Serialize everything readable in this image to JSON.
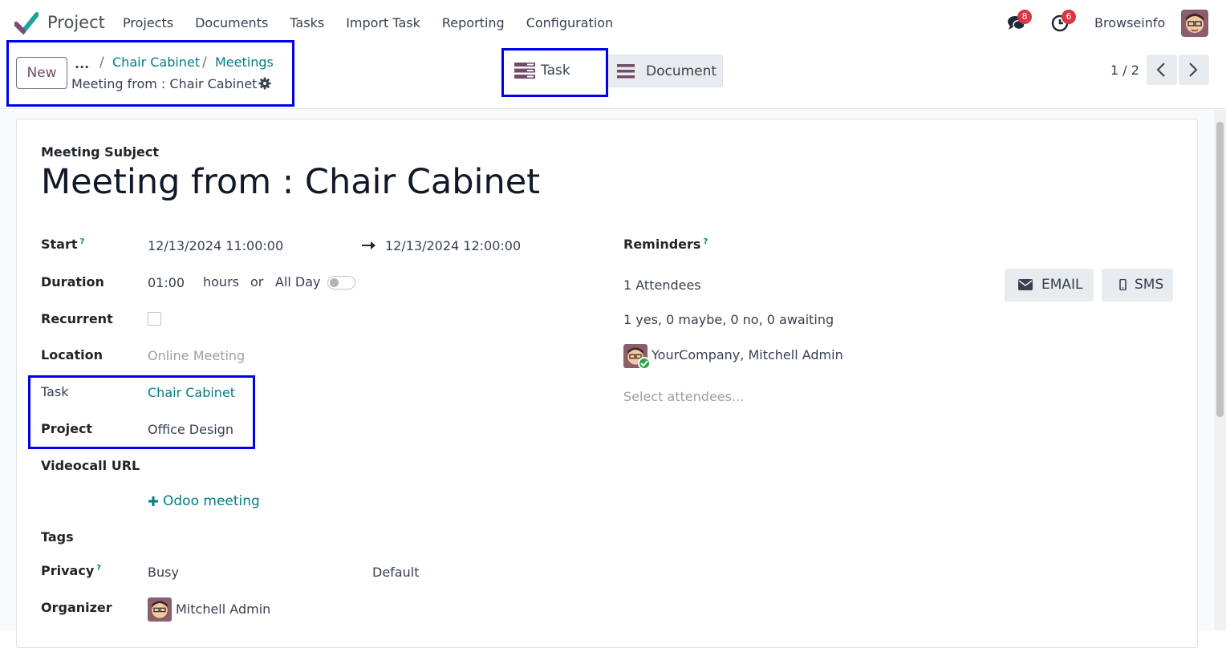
{
  "navbar": {
    "app_name": "Project",
    "menu": [
      "Projects",
      "Documents",
      "Tasks",
      "Import Task",
      "Reporting",
      "Configuration"
    ],
    "messages_badge": "8",
    "activities_badge": "6",
    "user": "Browseinfo"
  },
  "control": {
    "new_label": "New",
    "breadcrumb_dots": "...",
    "breadcrumb_sep": "/",
    "breadcrumb_1": "Chair Cabinet",
    "breadcrumb_2": "Meetings",
    "current_record": "Meeting from : Chair Cabinet",
    "smart_task": "Task",
    "smart_document": "Document",
    "pager": "1 / 2"
  },
  "form": {
    "subject_label": "Meeting Subject",
    "subject_value": "Meeting from : Chair Cabinet",
    "start_label": "Start",
    "hint_mark": "?",
    "start_value": "12/13/2024 11:00:00",
    "end_value": "12/13/2024 12:00:00",
    "duration_label": "Duration",
    "duration_value": "01:00",
    "duration_unit": "hours",
    "duration_or": "or",
    "allday_label": "All Day",
    "recurrent_label": "Recurrent",
    "location_label": "Location",
    "location_placeholder": "Online Meeting",
    "task_label": "Task",
    "task_value": "Chair Cabinet",
    "project_label": "Project",
    "project_value": "Office Design",
    "videocall_label": "Videocall URL",
    "odoo_meeting": "Odoo meeting",
    "tags_label": "Tags",
    "privacy_label": "Privacy",
    "privacy_value": "Busy",
    "privacy_default": "Default",
    "organizer_label": "Organizer",
    "organizer_value": "Mitchell Admin",
    "reminders_label": "Reminders",
    "attendees_count": "1 Attendees",
    "attendees_summary": "1 yes, 0 maybe, 0 no, 0 awaiting",
    "attendee_name": "YourCompany, Mitchell Admin",
    "select_attendees": "Select attendees...",
    "email_button": "EMAIL",
    "sms_button": "SMS"
  },
  "colors": {
    "brand": "#714b67",
    "link": "#017e84",
    "highlight": "#0000ee"
  }
}
